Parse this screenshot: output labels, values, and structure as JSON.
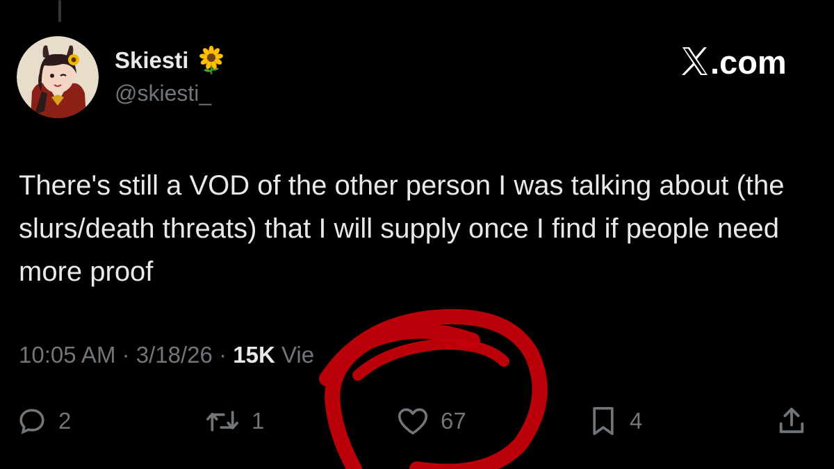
{
  "author": {
    "display_name": "Skiesti",
    "handle": "@skiesti_",
    "name_emoji": "sunflower-icon"
  },
  "watermark": {
    "label": ".com",
    "logo": "x-logo-icon"
  },
  "tweet": {
    "text": "There's still a VOD of the other person I was talking about (the slurs/death threats) that I will supply once I find if people need more proof"
  },
  "meta": {
    "time": "10:05 AM",
    "separator": "·",
    "date": "3/18/26",
    "views_count": "15K",
    "views_label": "Vie"
  },
  "actions": {
    "replies": "2",
    "reposts": "1",
    "likes": "67",
    "bookmarks": "4"
  },
  "colors": {
    "background": "#000000",
    "text": "#e7e9ea",
    "secondary": "#71767b",
    "annotation": "#c4000a"
  }
}
